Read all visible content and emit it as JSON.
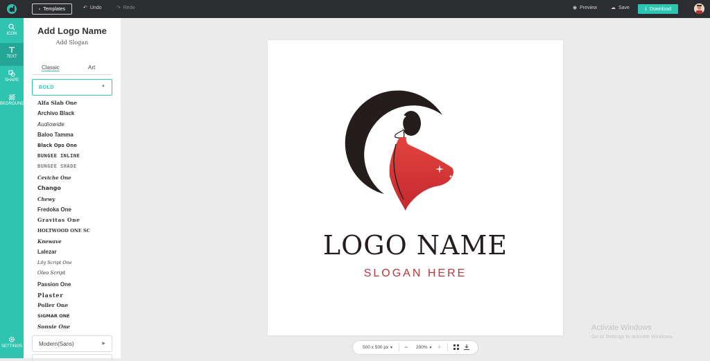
{
  "topbar": {
    "templates_label": "Templates",
    "undo_label": "Undo",
    "redo_label": "Redo",
    "preview_label": "Preview",
    "save_label": "Save",
    "download_label": "Download",
    "accent_color": "#2ec4b0"
  },
  "rail": {
    "items": [
      {
        "label": "ICON",
        "icon": "search-icon"
      },
      {
        "label": "TEXT",
        "icon": "text-icon"
      },
      {
        "label": "SHAPE",
        "icon": "shape-icon"
      },
      {
        "label": "BKGROUND",
        "icon": "background-icon"
      },
      {
        "label": "SETTINGS",
        "icon": "gear-icon"
      }
    ]
  },
  "panel": {
    "title": "Add Logo Name",
    "subtitle": "Add Slogan",
    "tabs": [
      "Classic",
      "Art"
    ],
    "category_selected": "BOLD",
    "fonts": [
      "Alfa Slab One",
      "Archivo Black",
      "Audiowide",
      "Baloo Tamma",
      "Black Ops One",
      "BUNGEE INLINE",
      "BUNGEE SHADE",
      "Ceviche One",
      "Chango",
      "Chewy",
      "Fredoka One",
      "Gravitas One",
      "HOLTWOOD ONE SC",
      "Knewave",
      "Lalezar",
      "Lily Script One",
      "Oleo Script",
      "Passion One",
      "Plaster",
      "Poller One",
      "SIGMAR ONE",
      "Sonsie One"
    ],
    "category2": "Modern(Sans)"
  },
  "canvas": {
    "logo_name": "LOGO NAME",
    "slogan": "SLOGAN HERE",
    "colors": {
      "dark": "#241d1b",
      "red": "#d0353a"
    }
  },
  "bottombar": {
    "size_label": "500 x 500 px",
    "zoom_label": "200%",
    "minus": "−",
    "plus": "+"
  },
  "watermark": {
    "line1": "Activate Windows",
    "line2": "Go to Settings to activate Windows."
  }
}
